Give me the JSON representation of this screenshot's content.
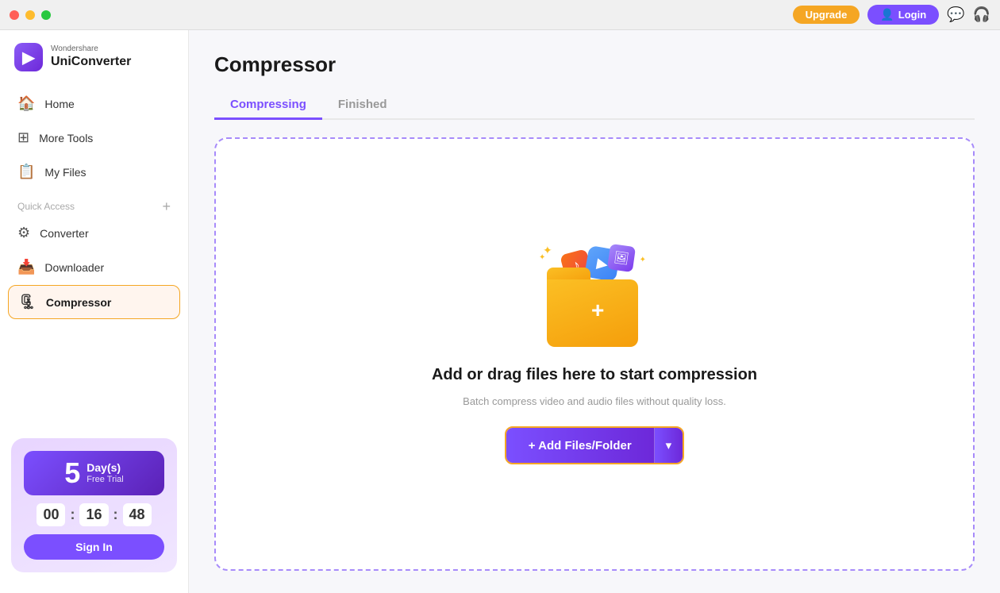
{
  "titlebar": {
    "upgrade_label": "Upgrade",
    "login_label": "Login",
    "login_icon": "👤",
    "chat_icon": "💬",
    "headphone_icon": "🎧"
  },
  "sidebar": {
    "logo": {
      "brand": "Wondershare",
      "name": "UniConverter",
      "icon": "▶"
    },
    "nav_items": [
      {
        "id": "home",
        "label": "Home",
        "icon": "🏠",
        "active": false
      },
      {
        "id": "more-tools",
        "label": "More Tools",
        "icon": "⊞",
        "active": false
      },
      {
        "id": "my-files",
        "label": "My Files",
        "icon": "📋",
        "active": false
      }
    ],
    "quick_access_label": "Quick Access",
    "add_btn_label": "+",
    "quick_access_items": [
      {
        "id": "converter",
        "label": "Converter",
        "icon": "⚙",
        "active": false
      },
      {
        "id": "downloader",
        "label": "Downloader",
        "icon": "📥",
        "active": false
      },
      {
        "id": "compressor",
        "label": "Compressor",
        "icon": "🗜",
        "active": true
      }
    ],
    "trial": {
      "days_number": "5",
      "days_label": "Day(s)",
      "free_label": "Free Trial",
      "timer_hh": "00",
      "timer_mm": "16",
      "timer_ss": "48",
      "sign_in_label": "Sign In"
    }
  },
  "main": {
    "page_title": "Compressor",
    "tabs": [
      {
        "id": "compressing",
        "label": "Compressing",
        "active": true
      },
      {
        "id": "finished",
        "label": "Finished",
        "active": false
      }
    ],
    "drop_zone": {
      "main_text": "Add or drag files here to start compression",
      "sub_text": "Batch compress video and audio files without quality loss.",
      "add_btn_label": "+ Add Files/Folder",
      "chevron": "▾"
    }
  }
}
